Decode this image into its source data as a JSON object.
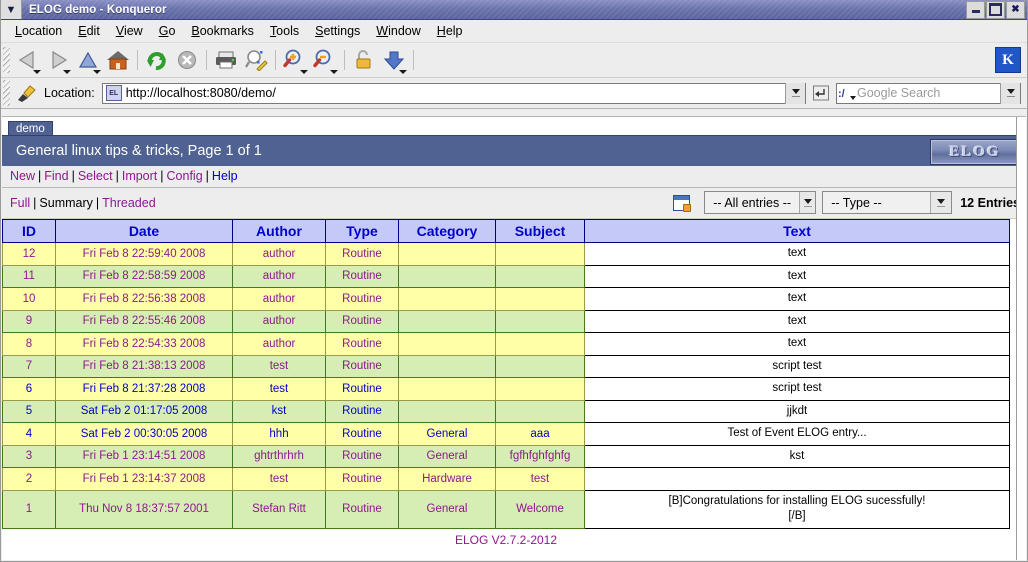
{
  "window": {
    "title": "ELOG demo - Konqueror",
    "menu_icon": "window-menu-icon",
    "minimize_label": "Minimize",
    "maximize_label": "Maximize",
    "close_label": "Close"
  },
  "menubar": {
    "items": [
      {
        "label": "Location",
        "accel": "L"
      },
      {
        "label": "Edit",
        "accel": "E"
      },
      {
        "label": "View",
        "accel": "V"
      },
      {
        "label": "Go",
        "accel": "G"
      },
      {
        "label": "Bookmarks",
        "accel": "B"
      },
      {
        "label": "Tools",
        "accel": "T"
      },
      {
        "label": "Settings",
        "accel": "S"
      },
      {
        "label": "Window",
        "accel": "W"
      },
      {
        "label": "Help",
        "accel": "H"
      }
    ]
  },
  "toolbar": {
    "buttons": [
      {
        "name": "back-button",
        "icon": "back-arrow-icon",
        "has_caret": true
      },
      {
        "name": "forward-button",
        "icon": "forward-arrow-icon",
        "has_caret": true
      },
      {
        "name": "up-button",
        "icon": "up-arrow-icon",
        "has_caret": true
      },
      {
        "name": "home-button",
        "icon": "home-icon",
        "has_caret": false
      },
      {
        "name": "reload-button",
        "icon": "reload-icon",
        "has_caret": false
      },
      {
        "name": "stop-button",
        "icon": "stop-icon",
        "has_caret": false
      },
      {
        "name": "print-button",
        "icon": "printer-icon",
        "has_caret": false
      },
      {
        "name": "find-button",
        "icon": "magnifier-pencil-icon",
        "has_caret": false
      },
      {
        "name": "zoom-in-button",
        "icon": "zoom-in-icon",
        "has_caret": true
      },
      {
        "name": "zoom-out-button",
        "icon": "zoom-out-icon",
        "has_caret": true
      },
      {
        "name": "security-button",
        "icon": "open-padlock-icon",
        "has_caret": false
      },
      {
        "name": "downloads-button",
        "icon": "blue-down-arrow-icon",
        "has_caret": true
      }
    ],
    "kde_logo_label": "K"
  },
  "location_bar": {
    "label": "Location:",
    "favicon_text": "EL",
    "url": "http://localhost:8080/demo/",
    "go_label": "Go",
    "search_placeholder": "Google Search",
    "search_value": "",
    "search_icon": "google-search-icon"
  },
  "elog": {
    "tab_label": "demo",
    "header_title": "General linux tips & tricks, Page 1 of 1",
    "logo_text": "ELOG",
    "nav_links": [
      {
        "label": "New",
        "visited": true
      },
      {
        "label": "Find",
        "visited": true
      },
      {
        "label": "Select",
        "visited": true
      },
      {
        "label": "Import",
        "visited": true
      },
      {
        "label": "Config",
        "visited": true
      },
      {
        "label": "Help",
        "visited": false
      }
    ],
    "view_modes": [
      {
        "label": "Full",
        "active": false
      },
      {
        "label": "Summary",
        "active": true
      },
      {
        "label": "Threaded",
        "active": false
      }
    ],
    "filter_icon": "new-entry-icon",
    "entries_select": {
      "value": "-- All entries --"
    },
    "type_select": {
      "value": "-- Type --"
    },
    "entries_count": "12 Entries",
    "footer": "ELOG V2.7.2-2012"
  },
  "table": {
    "columns": [
      "ID",
      "Date",
      "Author",
      "Type",
      "Category",
      "Subject",
      "Text"
    ],
    "rows": [
      {
        "id": "12",
        "date": "Fri Feb 8 22:59:40 2008",
        "author": "author",
        "type": "Routine",
        "category": "",
        "subject": "",
        "text": "text",
        "shade": "odd",
        "link_color": "purple"
      },
      {
        "id": "11",
        "date": "Fri Feb 8 22:58:59 2008",
        "author": "author",
        "type": "Routine",
        "category": "",
        "subject": "",
        "text": "text",
        "shade": "even",
        "link_color": "purple"
      },
      {
        "id": "10",
        "date": "Fri Feb 8 22:56:38 2008",
        "author": "author",
        "type": "Routine",
        "category": "",
        "subject": "",
        "text": "text",
        "shade": "odd",
        "link_color": "purple"
      },
      {
        "id": "9",
        "date": "Fri Feb 8 22:55:46 2008",
        "author": "author",
        "type": "Routine",
        "category": "",
        "subject": "",
        "text": "text",
        "shade": "even",
        "link_color": "purple"
      },
      {
        "id": "8",
        "date": "Fri Feb 8 22:54:33 2008",
        "author": "author",
        "type": "Routine",
        "category": "",
        "subject": "",
        "text": "text",
        "shade": "odd",
        "link_color": "purple"
      },
      {
        "id": "7",
        "date": "Fri Feb 8 21:38:13 2008",
        "author": "test",
        "type": "Routine",
        "category": "",
        "subject": "",
        "text": "script test",
        "shade": "even",
        "link_color": "purple"
      },
      {
        "id": "6",
        "date": "Fri Feb 8 21:37:28 2008",
        "author": "test",
        "type": "Routine",
        "category": "",
        "subject": "",
        "text": "script test",
        "shade": "odd",
        "link_color": "blue"
      },
      {
        "id": "5",
        "date": "Sat Feb 2 01:17:05 2008",
        "author": "kst",
        "type": "Routine",
        "category": "",
        "subject": "",
        "text": "jjkdt",
        "shade": "even",
        "link_color": "blue"
      },
      {
        "id": "4",
        "date": "Sat Feb 2 00:30:05 2008",
        "author": "hhh",
        "type": "Routine",
        "category": "General",
        "subject": "aaa",
        "text": "Test of Event ELOG entry...",
        "shade": "odd",
        "link_color": "blue"
      },
      {
        "id": "3",
        "date": "Fri Feb 1 23:14:51 2008",
        "author": "ghtrthrhrh",
        "type": "Routine",
        "category": "General",
        "subject": "fgfhfghfghfg",
        "text": "kst",
        "shade": "even",
        "link_color": "purple"
      },
      {
        "id": "2",
        "date": "Fri Feb 1 23:14:37 2008",
        "author": "test",
        "type": "Routine",
        "category": "Hardware",
        "subject": "test",
        "text": "",
        "shade": "odd",
        "link_color": "purple"
      },
      {
        "id": "1",
        "date": "Thu Nov 8 18:37:57 2001",
        "author": "Stefan Ritt",
        "type": "Routine",
        "category": "General",
        "subject": "Welcome",
        "text": "[B]Congratulations for installing ELOG sucessfully!\n[/B]",
        "shade": "even",
        "link_color": "purple"
      }
    ]
  },
  "colors": {
    "titlebar": "#5c649f",
    "elog_header": "#4f6292",
    "table_header_bg": "#c5c9f7",
    "table_header_fg": "#0000cc",
    "row_odd": "#ffffa8",
    "row_even": "#d6edb4",
    "link_visited": "#8b1a8b",
    "link_unvisited": "#0000cc"
  }
}
